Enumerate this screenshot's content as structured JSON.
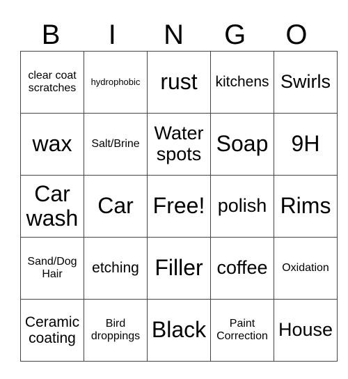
{
  "header": {
    "letters": [
      "B",
      "I",
      "N",
      "G",
      "O"
    ]
  },
  "cells": [
    [
      "clear coat scratches",
      "hydrophobic",
      "rust",
      "kitchens",
      "Swirls"
    ],
    [
      "wax",
      "Salt/Brine",
      "Water spots",
      "Soap",
      "9H"
    ],
    [
      "Car wash",
      "Car",
      "Free!",
      "polish",
      "Rims"
    ],
    [
      "Sand/Dog Hair",
      "etching",
      "Filler",
      "coffee",
      "Oxidation"
    ],
    [
      "Ceramic coating",
      "Bird droppings",
      "Black",
      "Paint Correction",
      "House"
    ]
  ]
}
